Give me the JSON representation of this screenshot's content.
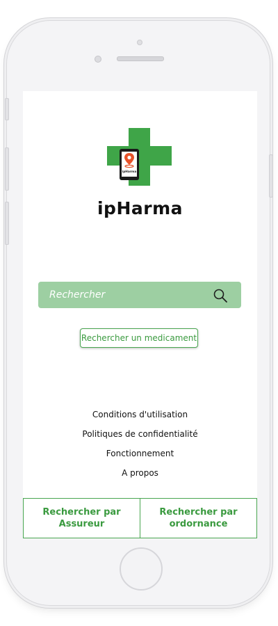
{
  "app": {
    "name": "ipHarma",
    "logo_text": "ipHarma",
    "brand_color": "#3fa548"
  },
  "search": {
    "placeholder": "Rechercher",
    "icon": "search-icon"
  },
  "medicament_button": {
    "label": "Rechercher un medicament"
  },
  "links": [
    {
      "label": "Conditions d'utilisation"
    },
    {
      "label": "Politiques de confidentialité"
    },
    {
      "label": "Fonctionnement"
    },
    {
      "label": "A propos"
    }
  ],
  "bottom_bar": {
    "left_label": "Rechercher par\nAssureur",
    "right_label": "Rechercher par\nordornance"
  }
}
